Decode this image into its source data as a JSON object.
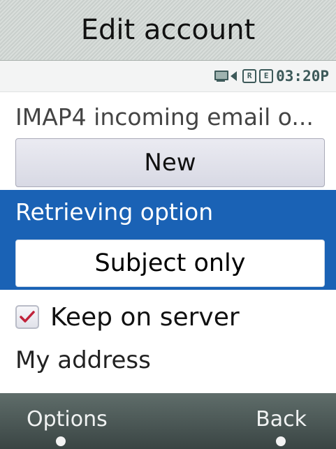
{
  "header": {
    "title": "Edit account"
  },
  "status": {
    "time": "03:20P",
    "box1": "R",
    "box2": "E"
  },
  "form": {
    "incoming_label": "IMAP4 incoming email o...",
    "incoming_value": "New",
    "retrieving_label": "Retrieving option",
    "retrieving_value": "Subject only",
    "keep_on_server_label": "Keep on server",
    "keep_on_server_checked": true,
    "my_address_label": "My address"
  },
  "softkeys": {
    "left": "Options",
    "right": "Back"
  },
  "colors": {
    "highlight": "#1a62b5",
    "check": "#c0223a"
  }
}
